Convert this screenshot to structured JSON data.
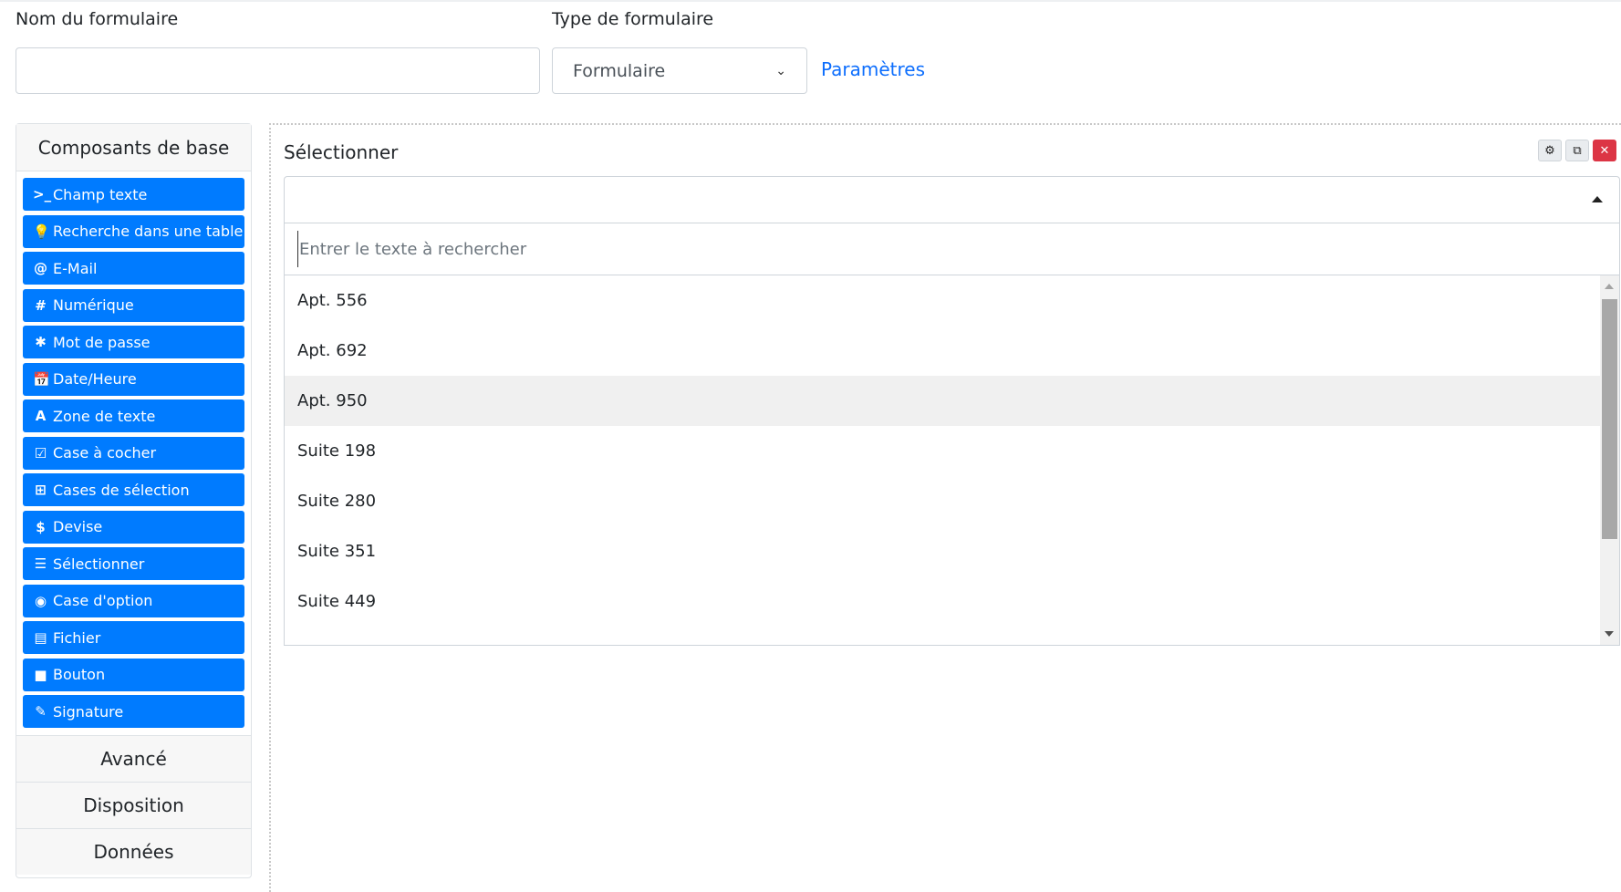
{
  "header": {
    "form_name_label": "Nom du formulaire",
    "form_name_value": "",
    "form_type_label": "Type de formulaire",
    "form_type_value": "Formulaire",
    "settings_link": "Paramètres"
  },
  "sidebar": {
    "title": "Composants de base",
    "items": [
      {
        "label": "Champ texte",
        "icon": ">_"
      },
      {
        "label": "Recherche dans une table",
        "icon": "💡"
      },
      {
        "label": "E-Mail",
        "icon": "@"
      },
      {
        "label": "Numérique",
        "icon": "#"
      },
      {
        "label": "Mot de passe",
        "icon": "✱"
      },
      {
        "label": "Date/Heure",
        "icon": "📅"
      },
      {
        "label": "Zone de texte",
        "icon": "A"
      },
      {
        "label": "Case à cocher",
        "icon": "☑"
      },
      {
        "label": "Cases de sélection",
        "icon": "⊞"
      },
      {
        "label": "Devise",
        "icon": "$"
      },
      {
        "label": "Sélectionner",
        "icon": "☰"
      },
      {
        "label": "Case d'option",
        "icon": "◉"
      },
      {
        "label": "Fichier",
        "icon": "▤"
      },
      {
        "label": "Bouton",
        "icon": "■"
      },
      {
        "label": "Signature",
        "icon": "✎"
      }
    ],
    "sections": [
      "Avancé",
      "Disposition",
      "Données"
    ]
  },
  "component": {
    "label": "Sélectionner",
    "tools": {
      "settings_icon": "⚙",
      "copy_icon": "⧉",
      "remove_icon": "✕"
    },
    "search_placeholder": "Entrer le texte à rechercher",
    "options": [
      "Apt. 556",
      "Apt. 692",
      "Apt. 950",
      "Suite 198",
      "Suite 280",
      "Suite 351",
      "Suite 449"
    ],
    "highlighted_option": "Apt. 950"
  },
  "colors": {
    "primary": "#007bff",
    "link": "#0d6efd",
    "danger": "#dc3545",
    "highlight": "#f0f0f0"
  }
}
